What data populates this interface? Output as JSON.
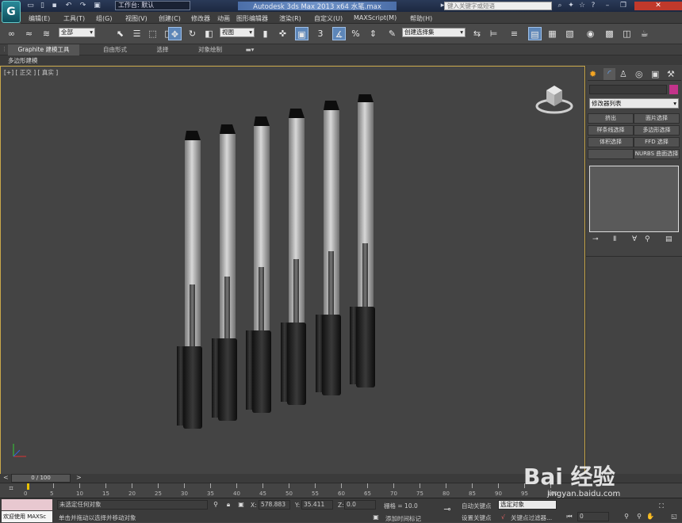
{
  "titlebar": {
    "logo": "G",
    "workspace_label": "工作台: 默认",
    "title": "Autodesk 3ds Max  2013 x64      水笔.max",
    "search_placeholder": "键入关键字或短语"
  },
  "menus": [
    "编辑(E)",
    "工具(T)",
    "组(G)",
    "视图(V)",
    "创建(C)",
    "修改器",
    "动画",
    "图形编辑器",
    "渲染(R)",
    "自定义(U)",
    "MAXScript(M)",
    "帮助(H)"
  ],
  "toolbar": {
    "selection_filter": "全部",
    "ref_coord": "视图",
    "named_selection": "创建选择集",
    "snap_labels": [
      "3",
      "%"
    ]
  },
  "ribbon": {
    "tabs": [
      "Graphite 建模工具",
      "自由形式",
      "选择",
      "对象绘制"
    ],
    "sub_label": "多边形建模"
  },
  "viewport": {
    "label": "[+] [ 正交 ] [ 真实 ]",
    "border_color": "#c9a84a"
  },
  "command_panel": {
    "modifier_list": "修改器列表",
    "buttons": [
      "挤出",
      "面片选择",
      "样条线选择",
      "多边形选择",
      "体积选择",
      "FFD 选择",
      "NURBS 曲面选择"
    ],
    "color_swatch": "#c2338a"
  },
  "timeline": {
    "frame_display": "0 / 100",
    "ticks": [
      0,
      5,
      10,
      15,
      20,
      25,
      30,
      35,
      40,
      45,
      50,
      55,
      60,
      65,
      70,
      75,
      80,
      85,
      90,
      95,
      100
    ]
  },
  "status": {
    "welcome": "欢迎使用 MAXSc",
    "selection_msg": "未选定任何对象",
    "prompt": "单击并拖动以选择并移动对象",
    "x_label": "X:",
    "x_value": "578.883",
    "y_label": "Y:",
    "y_value": "35.411",
    "z_label": "Z:",
    "z_value": "0.0",
    "grid": "栅格 = 10.0",
    "add_tag": "添加时间标记",
    "auto_key": "自动关键点",
    "set_key": "设置关键点",
    "key_dropdown": "选定对象",
    "key_filter": "关键点过滤器...",
    "frame_field": "0"
  },
  "watermark": {
    "brand": "Bai 经验",
    "url": "jingyan.baidu.com"
  }
}
